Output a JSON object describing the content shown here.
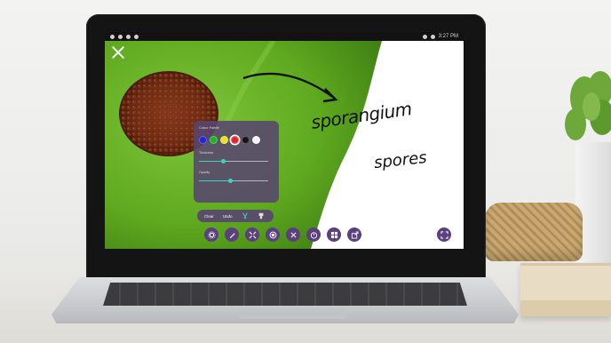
{
  "statusbar": {
    "time": "3:27 PM"
  },
  "annotations": {
    "label_1": "sporangium",
    "label_2": "spores"
  },
  "palette": {
    "title": "Colour Palette",
    "colors": [
      "#2424d6",
      "#19b526",
      "#e9e21a",
      "#e3252b",
      "#161616",
      "#f5f5f5"
    ],
    "selected_color_index": 3,
    "thickness_label": "Thickness",
    "thickness_value": 0.35,
    "opacity_label": "Opacity",
    "opacity_value": 0.45
  },
  "actions": {
    "clear_label": "Clear",
    "undo_label": "Undo"
  },
  "toolbar": {
    "tools": [
      "settings-icon",
      "pen-icon",
      "shape-icon",
      "record-icon",
      "split-icon",
      "timer-icon",
      "gallery-icon",
      "share-icon"
    ],
    "fullscreen": "fullscreen-icon"
  }
}
